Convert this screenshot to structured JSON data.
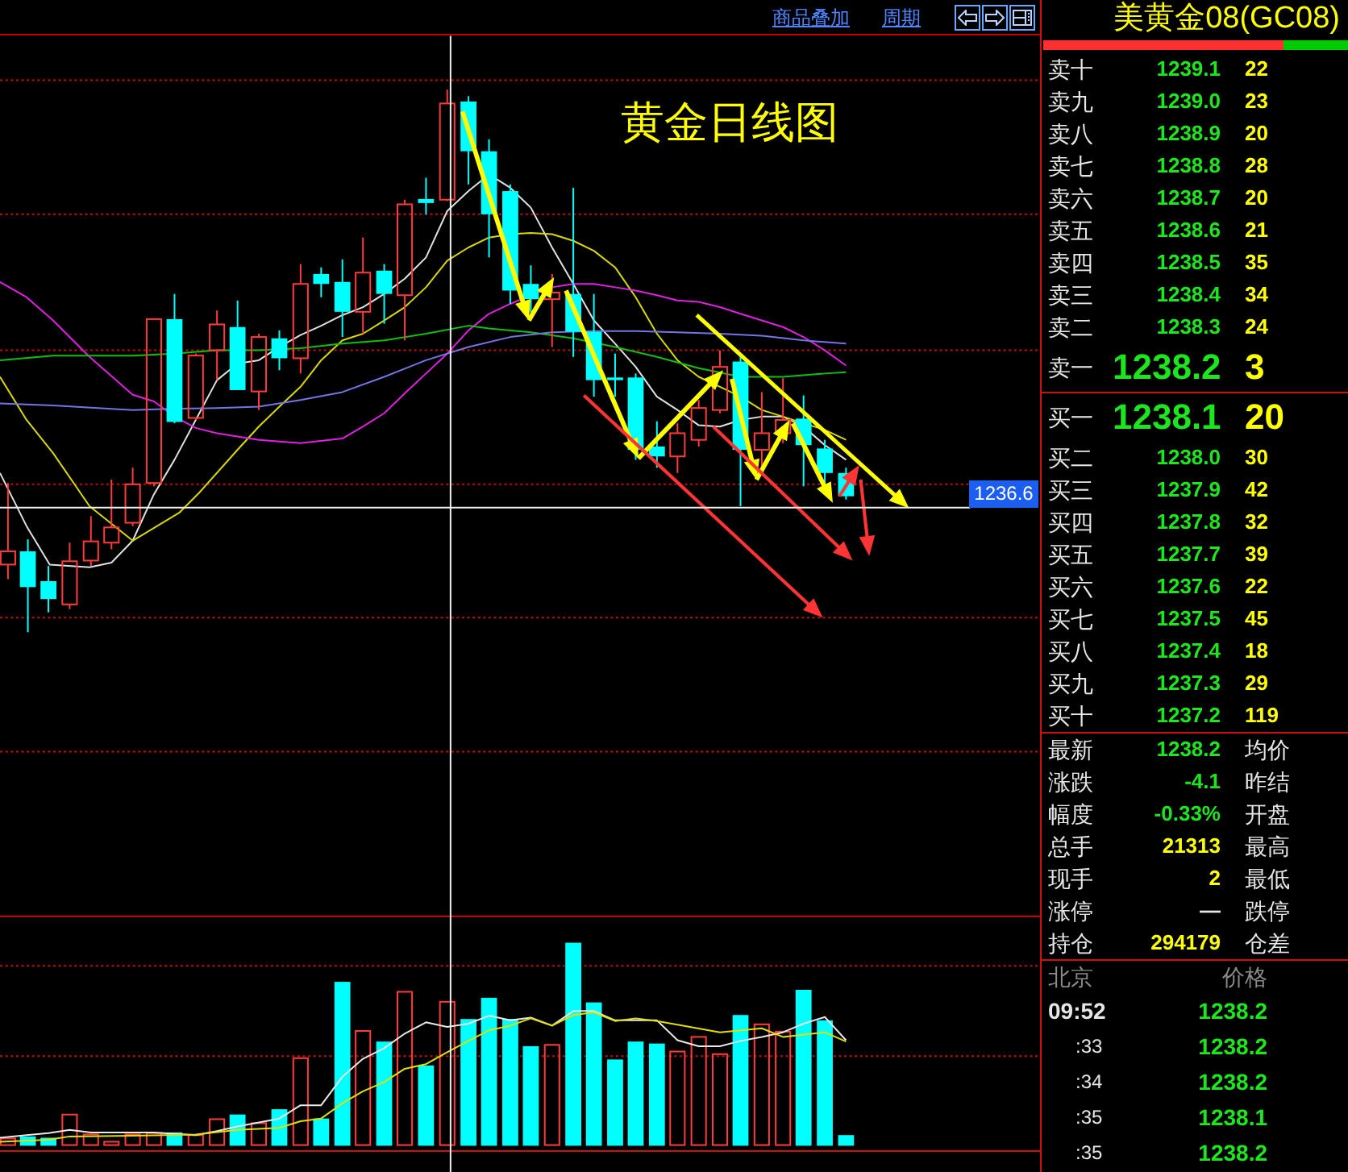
{
  "toolbar": {
    "links": [
      "商品叠加",
      "周期"
    ]
  },
  "chart": {
    "title": "黄金日线图",
    "price_label": "1236.6"
  },
  "quote": {
    "title": "美黄金08(GC08)",
    "ratio_bar": {
      "level": 0.79
    },
    "asks": [
      {
        "label": "卖十",
        "price": "1239.1",
        "volume": "22",
        "kind": "depth"
      },
      {
        "label": "卖九",
        "price": "1239.0",
        "volume": "23",
        "kind": "depth"
      },
      {
        "label": "卖八",
        "price": "1238.9",
        "volume": "20",
        "kind": "depth"
      },
      {
        "label": "卖七",
        "price": "1238.8",
        "volume": "28",
        "kind": "depth"
      },
      {
        "label": "卖六",
        "price": "1238.7",
        "volume": "20",
        "kind": "depth"
      },
      {
        "label": "卖五",
        "price": "1238.6",
        "volume": "21",
        "kind": "depth"
      },
      {
        "label": "卖四",
        "price": "1238.5",
        "volume": "35",
        "kind": "depth"
      },
      {
        "label": "卖三",
        "price": "1238.4",
        "volume": "34",
        "kind": "depth"
      },
      {
        "label": "卖二",
        "price": "1238.3",
        "volume": "24",
        "kind": "depth"
      },
      {
        "label": "卖一",
        "price": "1238.2",
        "volume": "3",
        "kind": "best"
      }
    ],
    "bids": [
      {
        "label": "买一",
        "price": "1238.1",
        "volume": "20",
        "kind": "best"
      },
      {
        "label": "买二",
        "price": "1238.0",
        "volume": "30",
        "kind": "depth"
      },
      {
        "label": "买三",
        "price": "1237.9",
        "volume": "42",
        "kind": "depth"
      },
      {
        "label": "买四",
        "price": "1237.8",
        "volume": "32",
        "kind": "depth"
      },
      {
        "label": "买五",
        "price": "1237.7",
        "volume": "39",
        "kind": "depth"
      },
      {
        "label": "买六",
        "price": "1237.6",
        "volume": "22",
        "kind": "depth"
      },
      {
        "label": "买七",
        "price": "1237.5",
        "volume": "45",
        "kind": "depth"
      },
      {
        "label": "买八",
        "price": "1237.4",
        "volume": "18",
        "kind": "depth"
      },
      {
        "label": "买九",
        "price": "1237.3",
        "volume": "29",
        "kind": "depth"
      },
      {
        "label": "买十",
        "price": "1237.2",
        "volume": "119",
        "kind": "depth"
      }
    ],
    "stats": [
      {
        "label": "最新",
        "value": "1238.2",
        "kind": "price",
        "right_label": "均价"
      },
      {
        "label": "涨跌",
        "value": "-4.1",
        "kind": "price",
        "right_label": "昨结"
      },
      {
        "label": "幅度",
        "value": "-0.33%",
        "kind": "price",
        "right_label": "开盘"
      },
      {
        "label": "总手",
        "value": "21313",
        "kind": "volume",
        "right_label": "最高"
      },
      {
        "label": "现手",
        "value": "2",
        "kind": "volume",
        "right_label": "最低"
      },
      {
        "label": "涨停",
        "value": "—",
        "kind": "plain",
        "right_label": "跌停"
      },
      {
        "label": "持仓",
        "value": "294179",
        "kind": "volume",
        "right_label": "仓差"
      }
    ],
    "ticks_header": {
      "time": "北京",
      "price": "价格"
    },
    "ticks": [
      {
        "time": "09:52",
        "price": "1238.2",
        "kind": "minute"
      },
      {
        "time": ":33",
        "price": "1238.2",
        "kind": "second"
      },
      {
        "time": ":34",
        "price": "1238.2",
        "kind": "second"
      },
      {
        "time": ":35",
        "price": "1238.1",
        "kind": "second"
      },
      {
        "time": ":35",
        "price": "1238.2",
        "kind": "second"
      }
    ]
  }
}
